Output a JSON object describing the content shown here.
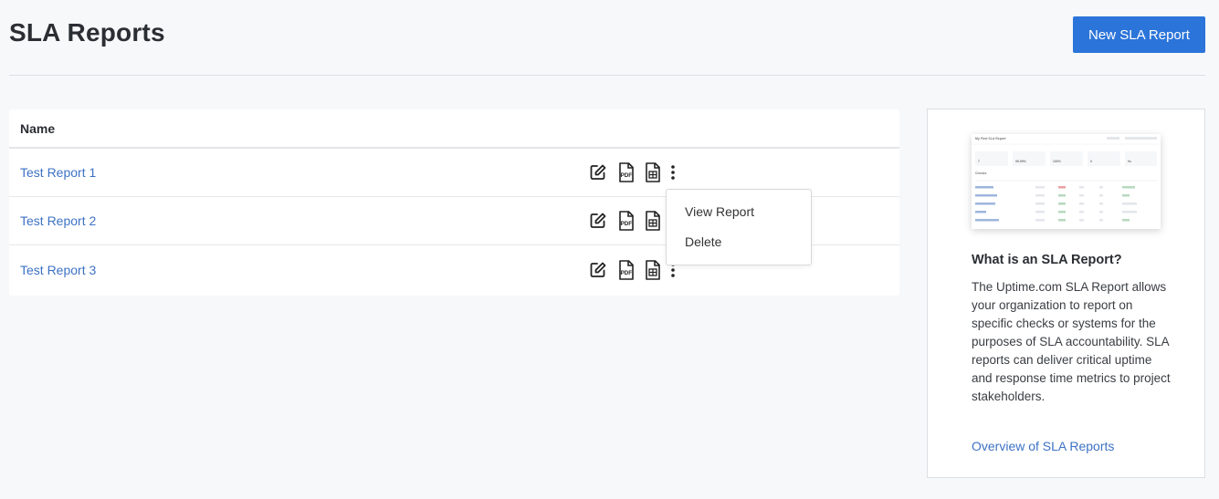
{
  "header": {
    "title": "SLA Reports",
    "new_button_label": "New SLA Report"
  },
  "table": {
    "column_name": "Name",
    "rows": [
      {
        "name": "Test Report 1"
      },
      {
        "name": "Test Report 2"
      },
      {
        "name": "Test Report 3"
      }
    ],
    "action_icons": [
      "edit-icon",
      "pdf-icon",
      "spreadsheet-icon",
      "more-vertical-icon"
    ]
  },
  "dropdown": {
    "items": [
      "View Report",
      "Delete"
    ]
  },
  "sidebar": {
    "title": "What is an SLA Report?",
    "description": "The Uptime.com SLA Report allows your organization to report on specific checks or systems for the purposes of SLA accountability. SLA reports can deliver critical uptime and response time metrics to project stakeholders.",
    "link_label": "Overview of SLA Reports",
    "preview": {
      "title": "My First SLA Report",
      "section": "Checks",
      "stats": [
        "7",
        "99.99%",
        "100%",
        "0",
        "0s"
      ]
    }
  },
  "colors": {
    "accent": "#2b74d9",
    "link": "#3d72c4",
    "background": "#f7f8fa"
  }
}
